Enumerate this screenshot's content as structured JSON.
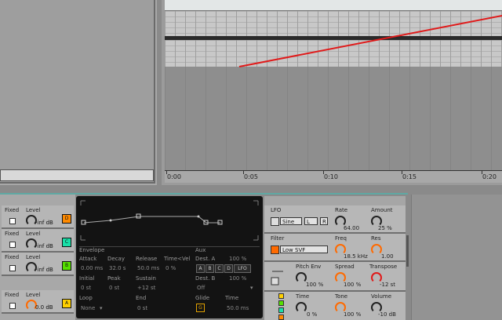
{
  "timeline": {
    "ruler_labels": [
      "0:00",
      "0:05",
      "0:10",
      "0:15",
      "0:20"
    ]
  },
  "drum_slots": [
    {
      "fixed_label": "Fixed",
      "level_label": "Level",
      "level_value": "-inf dB",
      "pad_letter": "D",
      "pad_color": "#ff8a00"
    },
    {
      "fixed_label": "Fixed",
      "level_label": "Level",
      "level_value": "-inf dB",
      "pad_letter": "C",
      "pad_color": "#19e0a8"
    },
    {
      "fixed_label": "Fixed",
      "level_label": "Level",
      "level_value": "-inf dB",
      "pad_letter": "B",
      "pad_color": "#55e000"
    },
    {
      "fixed_label": "Fixed",
      "level_label": "Level",
      "level_value": "0.0 dB",
      "pad_letter": "A",
      "pad_color": "#ffd000"
    }
  ],
  "envelope": {
    "title": "Envelope",
    "attack_label": "Attack",
    "attack_value": "0.00 ms",
    "decay_label": "Decay",
    "decay_value": "32.0 s",
    "release_label": "Release",
    "release_value": "50.0 ms",
    "timevel_label": "Time<Vel",
    "timevel_value": "0 %",
    "initial_label": "Initial",
    "initial_value": "0 st",
    "peak_label": "Peak",
    "peak_value": "0 st",
    "sustain_label": "Sustain",
    "sustain_value": "+12 st",
    "loop_label": "Loop",
    "loop_value": "None",
    "end_label": "End",
    "end_value": "0 st"
  },
  "aux": {
    "title": "Aux",
    "dest_a_label": "Dest. A",
    "dest_a_value": "100 %",
    "dest_buttons": [
      "A",
      "B",
      "C",
      "D",
      "LFO"
    ],
    "dest_b_label": "Dest. B",
    "dest_b_value": "100 %",
    "dest_b_select": "Off",
    "glide_label": "Glide",
    "glide_value": "G",
    "time_label": "Time",
    "time_value": "50.0 ms"
  },
  "lfo": {
    "title": "LFO",
    "wave": "Sine",
    "mode": "L",
    "retrig": "R",
    "rate_label": "Rate",
    "rate_value": "64.00",
    "amount_label": "Amount",
    "amount_value": "25 %"
  },
  "filter": {
    "title": "Filter",
    "type": "Low SVF",
    "freq_label": "Freq",
    "freq_value": "18.5 kHz",
    "res_label": "Res",
    "res_value": "1.00"
  },
  "pitch": {
    "pitch_env_label": "Pitch Env",
    "pitch_env_value": "100 %",
    "spread_label": "Spread",
    "spread_value": "100 %",
    "transpose_label": "Transpose",
    "transpose_value": "-12 st"
  },
  "output": {
    "time_label": "Time",
    "time_value": "0 %",
    "tone_label": "Tone",
    "tone_value": "100 %",
    "volume_label": "Volume",
    "volume_value": "-10 dB"
  },
  "colors": {
    "accent": "#ff6a00",
    "automation_line": "#e01a1a",
    "device_bar": "#5fa8a3"
  }
}
